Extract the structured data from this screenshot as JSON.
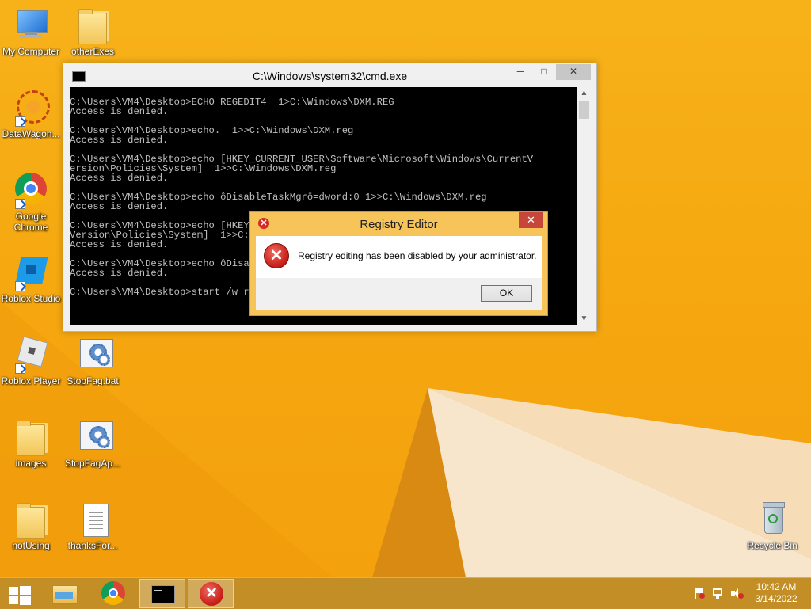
{
  "desktop": {
    "icons": [
      {
        "label": "My Computer"
      },
      {
        "label": "otherExes"
      },
      {
        "label": "DataWagon..."
      },
      {
        "label": "Google Chrome"
      },
      {
        "label": "Roblox Studio"
      },
      {
        "label": "Roblox Player"
      },
      {
        "label": "StopFag.bat"
      },
      {
        "label": "images"
      },
      {
        "label": "StopFagAp..."
      },
      {
        "label": "notUsing"
      },
      {
        "label": "thanksFor..."
      },
      {
        "label": "Recycle Bin"
      }
    ]
  },
  "cmd_window": {
    "title": "C:\\Windows\\system32\\cmd.exe",
    "lines": [
      "C:\\Users\\VM4\\Desktop>ECHO REGEDIT4  1>C:\\Windows\\DXM.REG",
      "Access is denied.",
      "",
      "C:\\Users\\VM4\\Desktop>echo.  1>>C:\\Windows\\DXM.reg",
      "Access is denied.",
      "",
      "C:\\Users\\VM4\\Desktop>echo [HKEY_CURRENT_USER\\Software\\Microsoft\\Windows\\CurrentV",
      "ersion\\Policies\\System]  1>>C:\\Windows\\DXM.reg",
      "Access is denied.",
      "",
      "C:\\Users\\VM4\\Desktop>echo ôDisableTaskMgrö=dword:0 1>>C:\\Windows\\DXM.reg",
      "Access is denied.",
      "",
      "C:\\Users\\VM4\\Desktop>echo [HKEY_CURRENT_USER\\Software\\Microsoft\\Windows\\Current",
      "Version\\Policies\\System]  1>>C:\\Windows\\DXM.reg",
      "Access is denied.",
      "",
      "C:\\Users\\VM4\\Desktop>echo ôDisableRegistryTools ö=dword:0 1>>C:\\Windows\\DXM.reg",
      "Access is denied.",
      "",
      "C:\\Users\\VM4\\Desktop>start /w regedit /s C:\\Windows\\DXM.reg"
    ],
    "minimize": "─",
    "maximize": "□",
    "close": "✕"
  },
  "dialog": {
    "title": "Registry Editor",
    "message": "Registry editing has been disabled by your administrator.",
    "ok_label": "OK",
    "close": "✕",
    "error_glyph": "✕",
    "accent": "#f7c45a"
  },
  "taskbar": {
    "time": "10:42 AM",
    "date": "3/14/2022"
  }
}
